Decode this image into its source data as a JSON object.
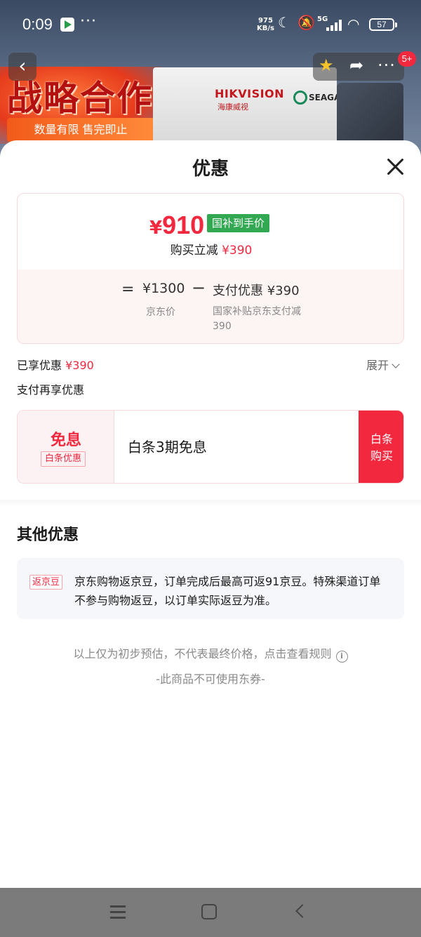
{
  "status_bar": {
    "time": "0:09",
    "more": "···",
    "speed_value": "975",
    "speed_unit": "KB/s",
    "network": "5G",
    "battery": "57"
  },
  "banner": {
    "headline": "战略合作",
    "tagline": "数量有限 售完即止",
    "brand_hik": "HIKVISION",
    "brand_hik_cn": "海康威视",
    "brand_seagate": "SEAGATE",
    "cart_badge": "5+"
  },
  "sheet": {
    "title": "优惠",
    "price_card": {
      "currency": "¥",
      "final_price": "910",
      "subsidy_tag": "国补到手价",
      "instant_cut_label": "购买立减",
      "instant_cut_amount": "¥390",
      "equals": "=",
      "jd_price": "¥1300",
      "jd_price_label": "京东价",
      "minus": "−",
      "pay_discount": "支付优惠 ¥390",
      "pay_discount_desc": "国家补贴京东支付减390"
    },
    "enjoyed_label": "已享优惠",
    "enjoyed_amount": "¥390",
    "expand_label": "展开",
    "pay_more_title": "支付再享优惠",
    "baitiao": {
      "headline": "免息",
      "tag": "白条优惠",
      "description": "白条3期免息",
      "buy_label_1": "白条",
      "buy_label_2": "购买"
    },
    "other_title": "其他优惠",
    "rebate": {
      "tag": "返京豆",
      "text": "京东购物返京豆，订单完成后最高可返91京豆。特殊渠道订单不参与购物返豆，以订单实际返豆为准。"
    },
    "disclaimer": "以上仅为初步预估，不代表最终价格，点击查看规则",
    "no_coupon": "-此商品不可使用东券-"
  },
  "colors": {
    "accent_red": "#f2283f",
    "subsidy_green": "#33a852",
    "nav_gray": "#7b7b7b"
  },
  "icons": [
    "back-arrow-icon",
    "star-icon",
    "share-icon",
    "more-icon",
    "close-icon",
    "chevron-down-icon",
    "info-icon",
    "nav-menu-icon",
    "nav-home-icon",
    "nav-back-icon"
  ]
}
